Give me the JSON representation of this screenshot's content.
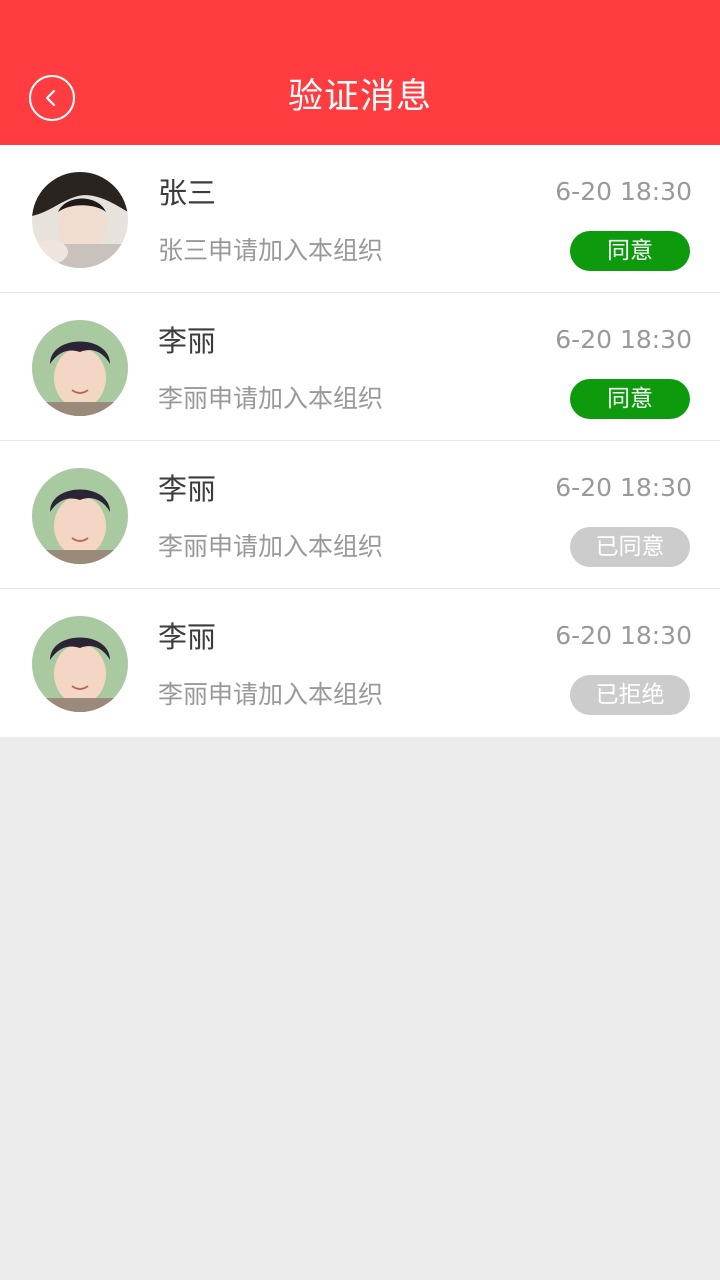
{
  "header": {
    "title": "验证消息",
    "back_icon": "chevron-left-icon"
  },
  "colors": {
    "header_bg": "#ff3d41",
    "agree_bg": "#0d9b0d",
    "done_bg": "#cccccc",
    "page_bg": "#ececec"
  },
  "messages": [
    {
      "name": "张三",
      "text": "张三申请加入本组织",
      "time": "6-20 18:30",
      "status": "同意",
      "status_type": "agree"
    },
    {
      "name": "李丽",
      "text": "李丽申请加入本组织",
      "time": "6-20 18:30",
      "status": "同意",
      "status_type": "agree"
    },
    {
      "name": "李丽",
      "text": "李丽申请加入本组织",
      "time": "6-20 18:30",
      "status": "已同意",
      "status_type": "done"
    },
    {
      "name": "李丽",
      "text": "李丽申请加入本组织",
      "time": "6-20 18:30",
      "status": "已拒绝",
      "status_type": "done"
    }
  ]
}
